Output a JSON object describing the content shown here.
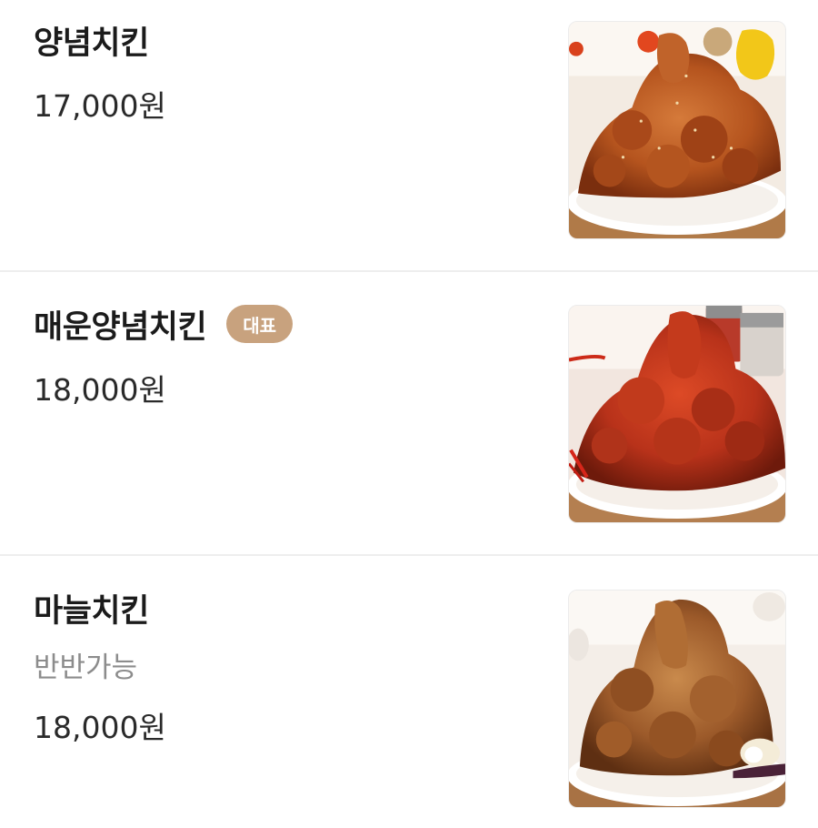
{
  "menu": {
    "items": [
      {
        "name": "양념치킨",
        "price": "17,000원",
        "image": "yangnyeom-chicken-photo",
        "sauce_color": "#b5541e"
      },
      {
        "name": "매운양념치킨",
        "badge": "대표",
        "price": "18,000원",
        "image": "spicy-yangnyeom-chicken-photo",
        "sauce_color": "#b8321a"
      },
      {
        "name": "마늘치킨",
        "description": "반반가능",
        "price": "18,000원",
        "image": "garlic-chicken-photo",
        "sauce_color": "#9c5a2a"
      }
    ]
  },
  "colors": {
    "badge_bg": "#c8a27e",
    "divider": "#eeeeee",
    "description": "#8c8c8c"
  }
}
